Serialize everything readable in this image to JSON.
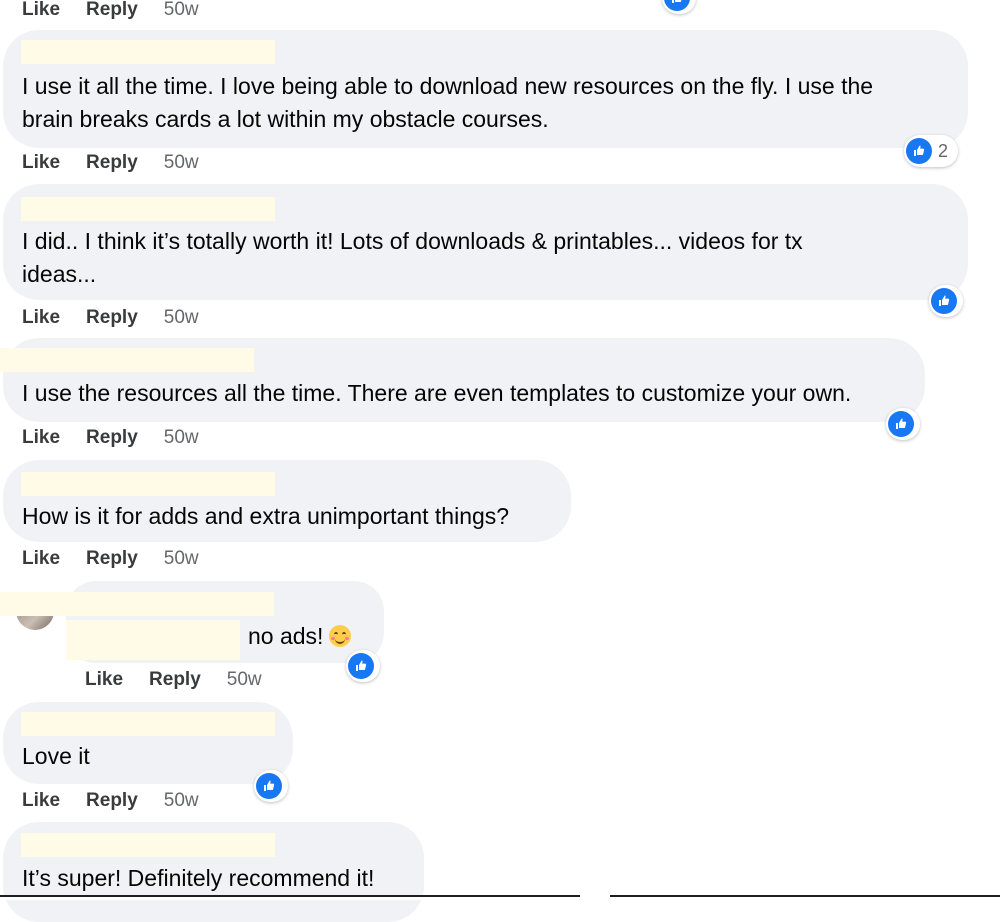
{
  "colors": {
    "bubble": "#f0f2f5",
    "like_blue": "#1877f2",
    "meta": "#65676b"
  },
  "icons": {
    "reaction": "thumbs-up-icon",
    "emoji": "smiling-face-icon"
  },
  "labels": {
    "like": "Like",
    "reply": "Reply"
  },
  "top_actions": {
    "time": "50w"
  },
  "comments": [
    {
      "text_lines": [
        "I use it all the time. I love being able to download new resources on the fly. I use the",
        "brain breaks cards a lot within my obstacle courses."
      ],
      "time": "50w",
      "reaction_count": "2"
    },
    {
      "text_lines": [
        "I did.. I think it’s totally worth it! Lots of downloads & printables... videos for tx",
        "ideas..."
      ],
      "time": "50w"
    },
    {
      "text_lines": [
        "I use the resources all the time. There are even templates to customize your own."
      ],
      "time": "50w"
    },
    {
      "text_lines": [
        "How is it for adds and extra unimportant things?"
      ],
      "time": "50w"
    },
    {
      "text_lines": [
        "no ads!"
      ],
      "time": "50w"
    },
    {
      "text_lines": [
        "Love it"
      ],
      "time": "50w"
    },
    {
      "text_lines": [
        "It’s super! Definitely recommend it!"
      ]
    }
  ]
}
